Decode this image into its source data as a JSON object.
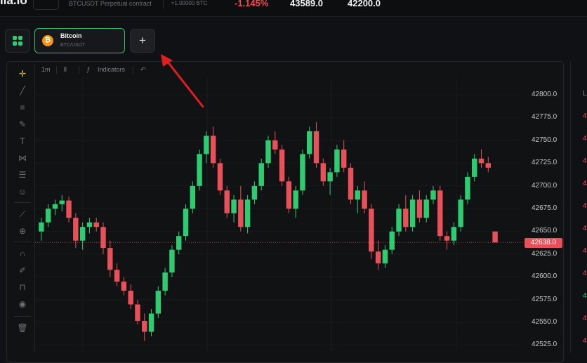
{
  "header": {
    "brand": "lia.io",
    "instrument": "BTCUSDT Perpetual contract",
    "btc_value": "≈1.00000 BTC",
    "change": "-1.145%",
    "price_a": "43589.0",
    "price_b": "42200.0"
  },
  "tabs": {
    "active": {
      "title": "Bitcoin",
      "subtitle": "BTC/USDT",
      "coin_glyph": "₿"
    },
    "add_label": "+"
  },
  "toolbar": {
    "interval": "1m",
    "indicators": "Indicators"
  },
  "price_scale": {
    "labels": [
      "42800.0",
      "42775.0",
      "42750.0",
      "42725.0",
      "42700.0",
      "42675.0",
      "42650.0",
      "42625.0",
      "42600.0",
      "42575.0",
      "42550.0",
      "42525.0"
    ],
    "current_price": "42638.0"
  },
  "right_strip": {
    "labels": [
      "L",
      "4",
      "4",
      "4",
      "4",
      "4",
      "4",
      "4",
      "4",
      "4",
      "4",
      "4"
    ]
  },
  "colors": {
    "up": "#2ecc71",
    "down": "#e8505a",
    "accent": "#27c46a",
    "arrow": "#e01e1e"
  },
  "chart_data": {
    "type": "candlestick",
    "interval": "1m",
    "ylim": [
      42520,
      42815
    ],
    "current_price": 42638.0,
    "candles": [
      [
        42650,
        42665,
        42640,
        42660
      ],
      [
        42660,
        42680,
        42655,
        42675
      ],
      [
        42675,
        42685,
        42668,
        42680
      ],
      [
        42680,
        42690,
        42672,
        42684
      ],
      [
        42684,
        42688,
        42660,
        42665
      ],
      [
        42665,
        42670,
        42632,
        42640
      ],
      [
        42640,
        42660,
        42630,
        42655
      ],
      [
        42655,
        42665,
        42648,
        42660
      ],
      [
        42660,
        42665,
        42650,
        42655
      ],
      [
        42655,
        42660,
        42625,
        42632
      ],
      [
        42632,
        42640,
        42600,
        42608
      ],
      [
        42608,
        42615,
        42590,
        42595
      ],
      [
        42595,
        42600,
        42580,
        42585
      ],
      [
        42585,
        42592,
        42565,
        42570
      ],
      [
        42570,
        42575,
        42548,
        42552
      ],
      [
        42552,
        42560,
        42530,
        42540
      ],
      [
        42540,
        42565,
        42535,
        42560
      ],
      [
        42560,
        42590,
        42555,
        42585
      ],
      [
        42585,
        42610,
        42580,
        42605
      ],
      [
        42605,
        42635,
        42600,
        42630
      ],
      [
        42630,
        42650,
        42625,
        42645
      ],
      [
        42645,
        42680,
        42640,
        42675
      ],
      [
        42675,
        42705,
        42670,
        42700
      ],
      [
        42700,
        42740,
        42695,
        42735
      ],
      [
        42735,
        42760,
        42725,
        42755
      ],
      [
        42755,
        42765,
        42720,
        42725
      ],
      [
        42725,
        42730,
        42690,
        42695
      ],
      [
        42695,
        42700,
        42665,
        42670
      ],
      [
        42670,
        42690,
        42660,
        42685
      ],
      [
        42685,
        42700,
        42650,
        42655
      ],
      [
        42655,
        42690,
        42648,
        42685
      ],
      [
        42685,
        42705,
        42680,
        42700
      ],
      [
        42700,
        42730,
        42695,
        42725
      ],
      [
        42725,
        42755,
        42720,
        42750
      ],
      [
        42750,
        42760,
        42735,
        42740
      ],
      [
        42740,
        42745,
        42700,
        42705
      ],
      [
        42705,
        42710,
        42670,
        42675
      ],
      [
        42675,
        42700,
        42665,
        42695
      ],
      [
        42695,
        42740,
        42690,
        42735
      ],
      [
        42735,
        42765,
        42730,
        42760
      ],
      [
        42760,
        42770,
        42720,
        42725
      ],
      [
        42725,
        42730,
        42700,
        42705
      ],
      [
        42705,
        42720,
        42690,
        42715
      ],
      [
        42715,
        42745,
        42710,
        42740
      ],
      [
        42740,
        42750,
        42715,
        42720
      ],
      [
        42720,
        42725,
        42680,
        42685
      ],
      [
        42685,
        42700,
        42670,
        42695
      ],
      [
        42695,
        42705,
        42670,
        42675
      ],
      [
        42675,
        42680,
        42620,
        42628
      ],
      [
        42628,
        42640,
        42608,
        42615
      ],
      [
        42615,
        42635,
        42610,
        42630
      ],
      [
        42630,
        42655,
        42625,
        42650
      ],
      [
        42650,
        42680,
        42645,
        42675
      ],
      [
        42675,
        42690,
        42650,
        42655
      ],
      [
        42655,
        42690,
        42650,
        42685
      ],
      [
        42685,
        42695,
        42660,
        42665
      ],
      [
        42665,
        42690,
        42660,
        42685
      ],
      [
        42685,
        42700,
        42680,
        42695
      ],
      [
        42695,
        42700,
        42640,
        42645
      ],
      [
        42645,
        42650,
        42630,
        42640
      ],
      [
        42640,
        42660,
        42635,
        42655
      ],
      [
        42655,
        42690,
        42650,
        42685
      ],
      [
        42685,
        42715,
        42680,
        42710
      ],
      [
        42710,
        42735,
        42705,
        42730
      ],
      [
        42730,
        42740,
        42720,
        42725
      ],
      [
        42725,
        42732,
        42715,
        42720
      ],
      [
        42650,
        42650,
        42638,
        42638
      ]
    ]
  }
}
